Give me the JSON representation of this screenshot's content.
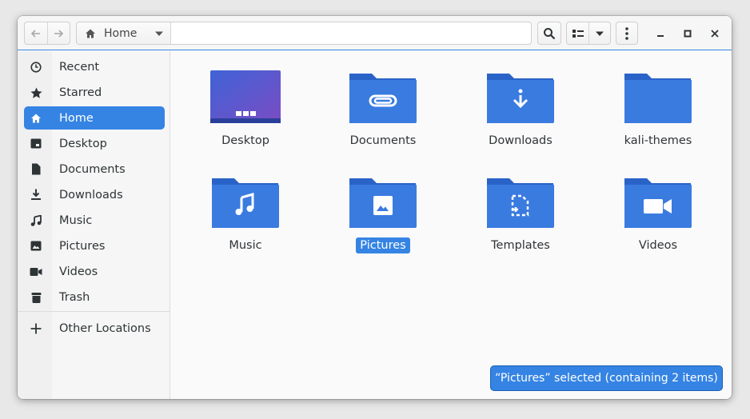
{
  "path": {
    "current": "Home"
  },
  "sidebar": {
    "items": [
      {
        "label": "Recent",
        "icon": "clock-icon"
      },
      {
        "label": "Starred",
        "icon": "star-icon"
      },
      {
        "label": "Home",
        "icon": "home-icon",
        "active": true
      },
      {
        "label": "Desktop",
        "icon": "desktop-icon"
      },
      {
        "label": "Documents",
        "icon": "document-icon"
      },
      {
        "label": "Downloads",
        "icon": "download-icon"
      },
      {
        "label": "Music",
        "icon": "music-note-icon"
      },
      {
        "label": "Pictures",
        "icon": "image-icon"
      },
      {
        "label": "Videos",
        "icon": "video-camera-icon"
      },
      {
        "label": "Trash",
        "icon": "trash-icon"
      }
    ],
    "other_locations": {
      "label": "Other Locations",
      "icon": "plus-icon"
    }
  },
  "files": [
    {
      "name": "Desktop",
      "icon": "desktop-folder-icon"
    },
    {
      "name": "Documents",
      "icon": "paperclip-folder-icon"
    },
    {
      "name": "Downloads",
      "icon": "download-folder-icon"
    },
    {
      "name": "kali-themes",
      "icon": "folder-icon"
    },
    {
      "name": "Music",
      "icon": "music-folder-icon"
    },
    {
      "name": "Pictures",
      "icon": "pictures-folder-icon",
      "selected": true
    },
    {
      "name": "Templates",
      "icon": "templates-folder-icon"
    },
    {
      "name": "Videos",
      "icon": "videos-folder-icon"
    }
  ],
  "status": {
    "text": "“Pictures” selected  (containing 2 items)"
  },
  "colors": {
    "accent": "#3584e4",
    "folder": "#3a7be0",
    "folder_tab": "#2a63c8"
  }
}
